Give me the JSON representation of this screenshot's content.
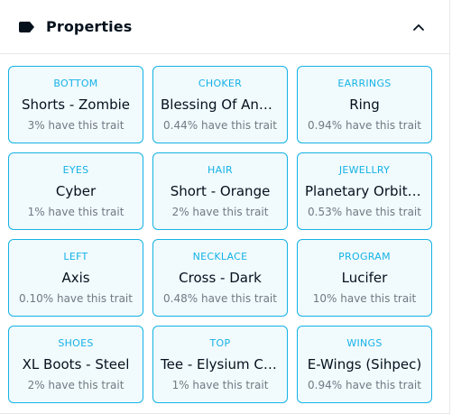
{
  "header": {
    "title": "Properties",
    "icon": "tag-icon",
    "toggle_icon": "chevron-up-icon"
  },
  "colors": {
    "accent": "#15b2e5",
    "card_bg": "#f0fafd",
    "text": "#04111d",
    "muted": "#707a83"
  },
  "traits": [
    {
      "type": "BOTTOM",
      "value": "Shorts - Zombie",
      "rarity": "3% have this trait"
    },
    {
      "type": "CHOKER",
      "value": "Blessing Of Angels",
      "rarity": "0.44% have this trait"
    },
    {
      "type": "EARRINGS",
      "value": "Ring",
      "rarity": "0.94% have this trait"
    },
    {
      "type": "EYES",
      "value": "Cyber",
      "rarity": "1% have this trait"
    },
    {
      "type": "HAIR",
      "value": "Short - Orange",
      "rarity": "2% have this trait"
    },
    {
      "type": "JEWELLRY",
      "value": "Planetary Orbit Ring",
      "rarity": "0.53% have this trait"
    },
    {
      "type": "LEFT",
      "value": "Axis",
      "rarity": "0.10% have this trait"
    },
    {
      "type": "NECKLACE",
      "value": "Cross - Dark",
      "rarity": "0.48% have this trait"
    },
    {
      "type": "PROGRAM",
      "value": "Lucifer",
      "rarity": "10% have this trait"
    },
    {
      "type": "SHOES",
      "value": "XL Boots - Steel",
      "rarity": "2% have this trait"
    },
    {
      "type": "TOP",
      "value": "Tee - Elysium Crew",
      "rarity": "1% have this trait"
    },
    {
      "type": "WINGS",
      "value": "E-Wings (Sihpec)",
      "rarity": "0.94% have this trait"
    }
  ]
}
